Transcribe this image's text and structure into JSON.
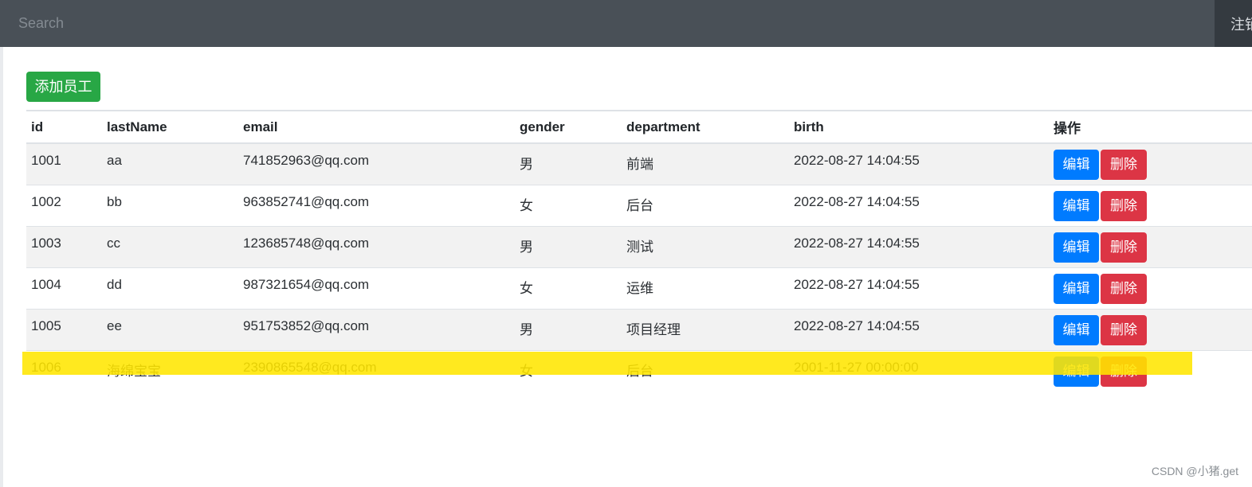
{
  "navbar": {
    "search_placeholder": "Search",
    "signout_label": "注销"
  },
  "toolbar": {
    "add_label": "添加员工"
  },
  "table": {
    "columns": [
      "id",
      "lastName",
      "email",
      "gender",
      "department",
      "birth",
      "操作"
    ],
    "rows": [
      {
        "id": "1001",
        "lastName": "aa",
        "email": "741852963@qq.com",
        "gender": "男",
        "department": "前端",
        "birth": "2022-08-27 14:04:55",
        "edit": "编辑",
        "delete": "删除"
      },
      {
        "id": "1002",
        "lastName": "bb",
        "email": "963852741@qq.com",
        "gender": "女",
        "department": "后台",
        "birth": "2022-08-27 14:04:55",
        "edit": "编辑",
        "delete": "删除"
      },
      {
        "id": "1003",
        "lastName": "cc",
        "email": "123685748@qq.com",
        "gender": "男",
        "department": "测试",
        "birth": "2022-08-27 14:04:55",
        "edit": "编辑",
        "delete": "删除"
      },
      {
        "id": "1004",
        "lastName": "dd",
        "email": "987321654@qq.com",
        "gender": "女",
        "department": "运维",
        "birth": "2022-08-27 14:04:55",
        "edit": "编辑",
        "delete": "删除"
      },
      {
        "id": "1005",
        "lastName": "ee",
        "email": "951753852@qq.com",
        "gender": "男",
        "department": "项目经理",
        "birth": "2022-08-27 14:04:55",
        "edit": "编辑",
        "delete": "删除"
      },
      {
        "id": "1006",
        "lastName": "海绵宝宝",
        "email": "2390865548@qq.com",
        "gender": "女",
        "department": "后台",
        "birth": "2001-11-27 00:00:00",
        "edit": "编辑",
        "delete": "删除"
      }
    ]
  },
  "watermark": "CSDN @小猪.get",
  "colors": {
    "navbar": "#495057",
    "add_button": "#28a745",
    "edit_button": "#007bff",
    "delete_button": "#dc3545",
    "highlight": "#ffe600"
  }
}
